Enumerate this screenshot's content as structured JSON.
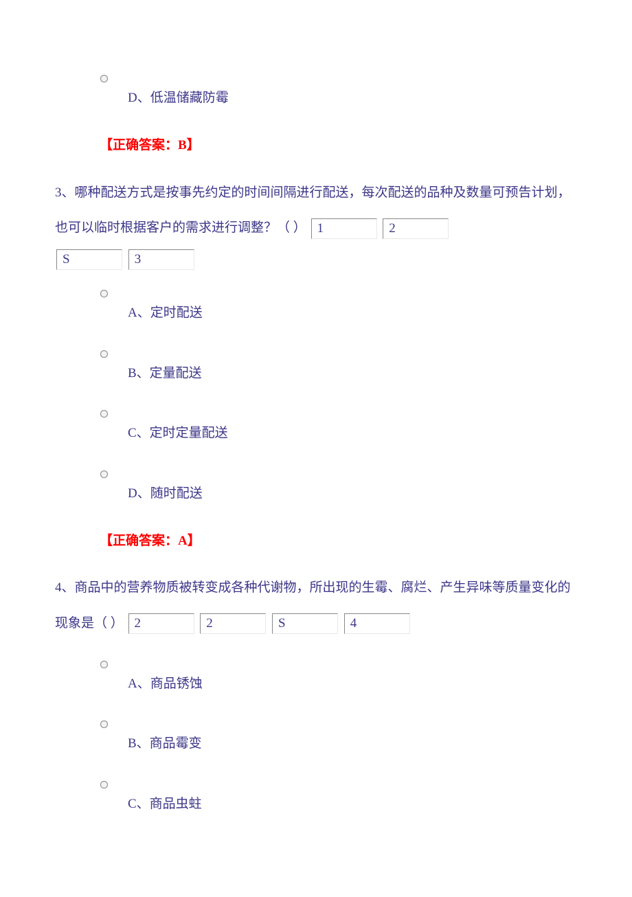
{
  "q2_tail": {
    "option_d": "D、低温储藏防霉",
    "answer_prefix": "【正确答案：",
    "answer_letter": "B",
    "answer_suffix": "】"
  },
  "q3": {
    "num": "3",
    "text_part1": "、哪种配送方式是按事先约定的时间间隔进行配送，每次配送的品种及数量可预告计划，也可以临时根据客户的需求进行调整？（ ）",
    "box1": "1",
    "box2": "2",
    "box3": "S",
    "box4": "3",
    "option_a": "A、定时配送",
    "option_b": "B、定量配送",
    "option_c": "C、定时定量配送",
    "option_d": "D、随时配送",
    "answer_prefix": "【正确答案：",
    "answer_letter": "A",
    "answer_suffix": "】"
  },
  "q4": {
    "num": "4",
    "text_part1": "、商品中的营养物质被转变成各种代谢物，所出现的生霉、腐烂、产生异味等质量变化的现象是（ ）",
    "box1": "2",
    "box2": "2",
    "box3": "S",
    "box4": "4",
    "option_a": "A、商品锈蚀",
    "option_b": "B、商品霉变",
    "option_c": "C、商品虫蛀"
  }
}
